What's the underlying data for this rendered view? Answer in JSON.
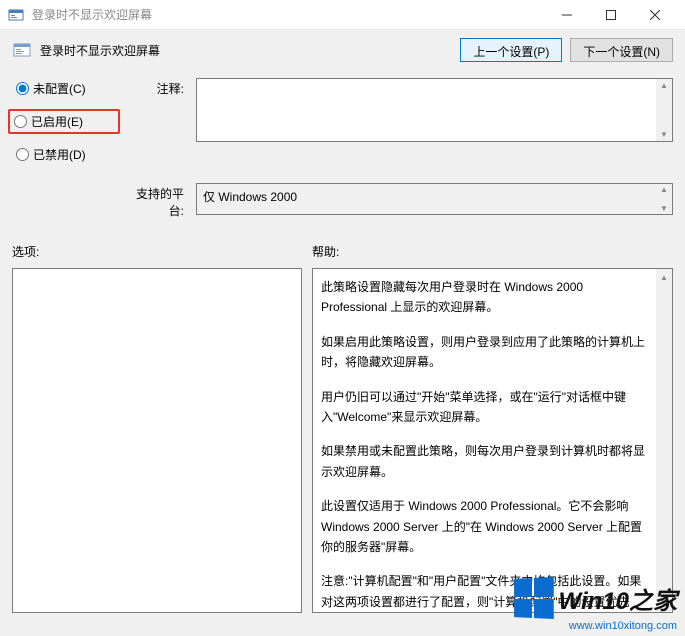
{
  "window": {
    "title": "登录时不显示欢迎屏幕"
  },
  "header": {
    "policy_title": "登录时不显示欢迎屏幕",
    "prev_setting": "上一个设置(P)",
    "next_setting": "下一个设置(N)"
  },
  "radios": {
    "not_configured": "未配置(C)",
    "enabled": "已启用(E)",
    "disabled": "已禁用(D)"
  },
  "labels": {
    "comment": "注释:",
    "supported": "支持的平台:",
    "options": "选项:",
    "help": "帮助:"
  },
  "platform": {
    "value": "仅 Windows 2000"
  },
  "help_text": {
    "p1": "此策略设置隐藏每次用户登录时在 Windows 2000 Professional 上显示的欢迎屏幕。",
    "p2": "如果启用此策略设置，则用户登录到应用了此策略的计算机上时，将隐藏欢迎屏幕。",
    "p3": "用户仍旧可以通过\"开始\"菜单选择，或在\"运行\"对话框中键入\"Welcome\"来显示欢迎屏幕。",
    "p4": "如果禁用或未配置此策略，则每次用户登录到计算机时都将显示欢迎屏幕。",
    "p5": "此设置仅适用于 Windows 2000 Professional。它不会影响 Windows 2000 Server 上的\"在 Windows 2000 Server 上配置你的服务器\"屏幕。",
    "p6": "注意:\"计算机配置\"和\"用户配置\"文件夹中均包括此设置。如果对这两项设置都进行了配置，则\"计算机配置\"中的设置优先于\"用户配置\"中的设置。"
  },
  "watermark": {
    "brand": "Win10之家",
    "url": "www.win10xitong.com"
  }
}
